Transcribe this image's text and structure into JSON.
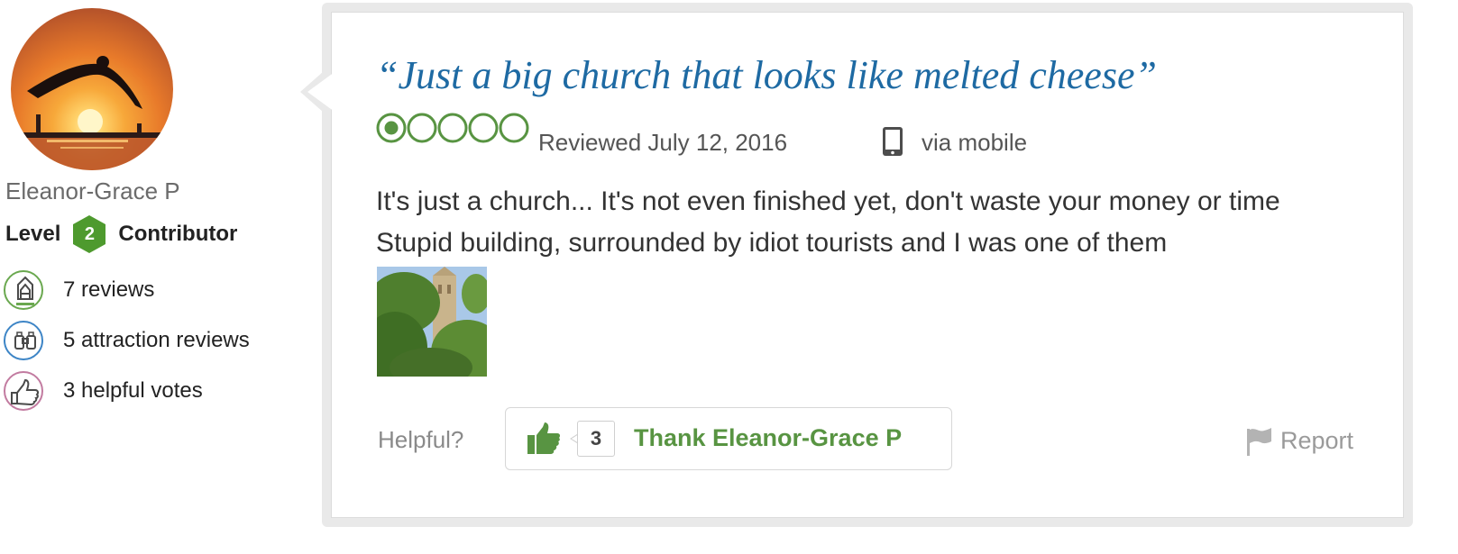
{
  "reviewer": {
    "name": "Eleanor-Grace P",
    "level_prefix": "Level",
    "level_number": "2",
    "level_suffix": "Contributor",
    "stats": [
      {
        "icon": "reviews-pen-icon",
        "color": "#6aa84f",
        "text": "7 reviews"
      },
      {
        "icon": "binoculars-icon",
        "color": "#3d85c6",
        "text": "5 attraction reviews"
      },
      {
        "icon": "thumbs-up-icon",
        "color": "#c27ba0",
        "text": "3 helpful votes"
      }
    ]
  },
  "review": {
    "title": "“Just a big church that looks like melted cheese”",
    "rating": 1,
    "rating_max": 5,
    "date": "Reviewed July 12, 2016",
    "via": "via mobile",
    "body": "It's just a church... It's not even finished yet, don't waste your money or time Stupid building, surrounded by idiot tourists and I was one of them"
  },
  "footer": {
    "helpful_label": "Helpful?",
    "vote_count": "3",
    "thank_label": "Thank Eleanor-Grace P",
    "report_label": "Report"
  },
  "colors": {
    "title_blue": "#1e6aa3",
    "rating_green": "#589442",
    "thank_green": "#589442",
    "level_badge_green": "#4e9a2e"
  }
}
